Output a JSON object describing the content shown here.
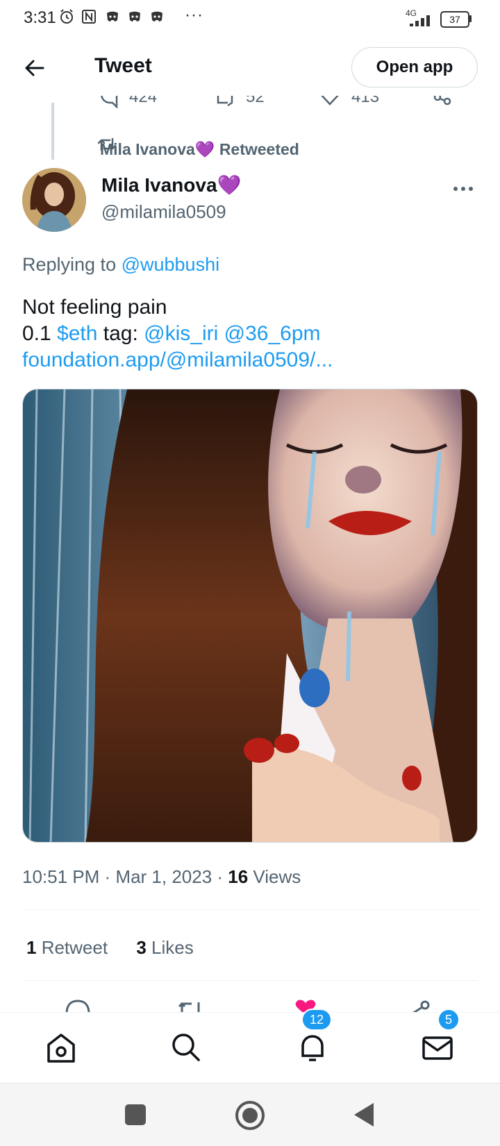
{
  "status_bar": {
    "time": "3:31",
    "more": "···",
    "network": "4G",
    "battery": "37"
  },
  "header": {
    "title": "Tweet",
    "open_app_label": "Open app"
  },
  "prev_tweet_stats": {
    "replies": "424",
    "retweets": "52",
    "likes": "413"
  },
  "retweet_context": {
    "name": "Mila Ivanova💜",
    "label": "Retweeted"
  },
  "author": {
    "name": "Mila Ivanova💜",
    "handle": "@milamila0509"
  },
  "reply": {
    "prefix": "Replying to ",
    "handle": "@wubbushi"
  },
  "tweet": {
    "line1": "Not feeling pain",
    "price": "0.1 ",
    "cashtag": "$eth",
    "tag_label": " tag: ",
    "mention1": "@kis_iri",
    "mention2": "@36_6pm",
    "link": "foundation.app/@milamila0509/..."
  },
  "meta": {
    "time": "10:51 PM",
    "sep": " · ",
    "date": "Mar 1, 2023",
    "views_count": "16",
    "views_label": " Views"
  },
  "engagement": {
    "retweets_count": "1",
    "retweets_label": " Retweet",
    "likes_count": "3",
    "likes_label": " Likes"
  },
  "bottom_nav": {
    "notifications_badge": "12",
    "messages_badge": "5"
  },
  "colors": {
    "accent": "#1d9bf0",
    "like": "#f91880",
    "secondary_text": "#536471",
    "heart_purple": "#b07fd8"
  }
}
